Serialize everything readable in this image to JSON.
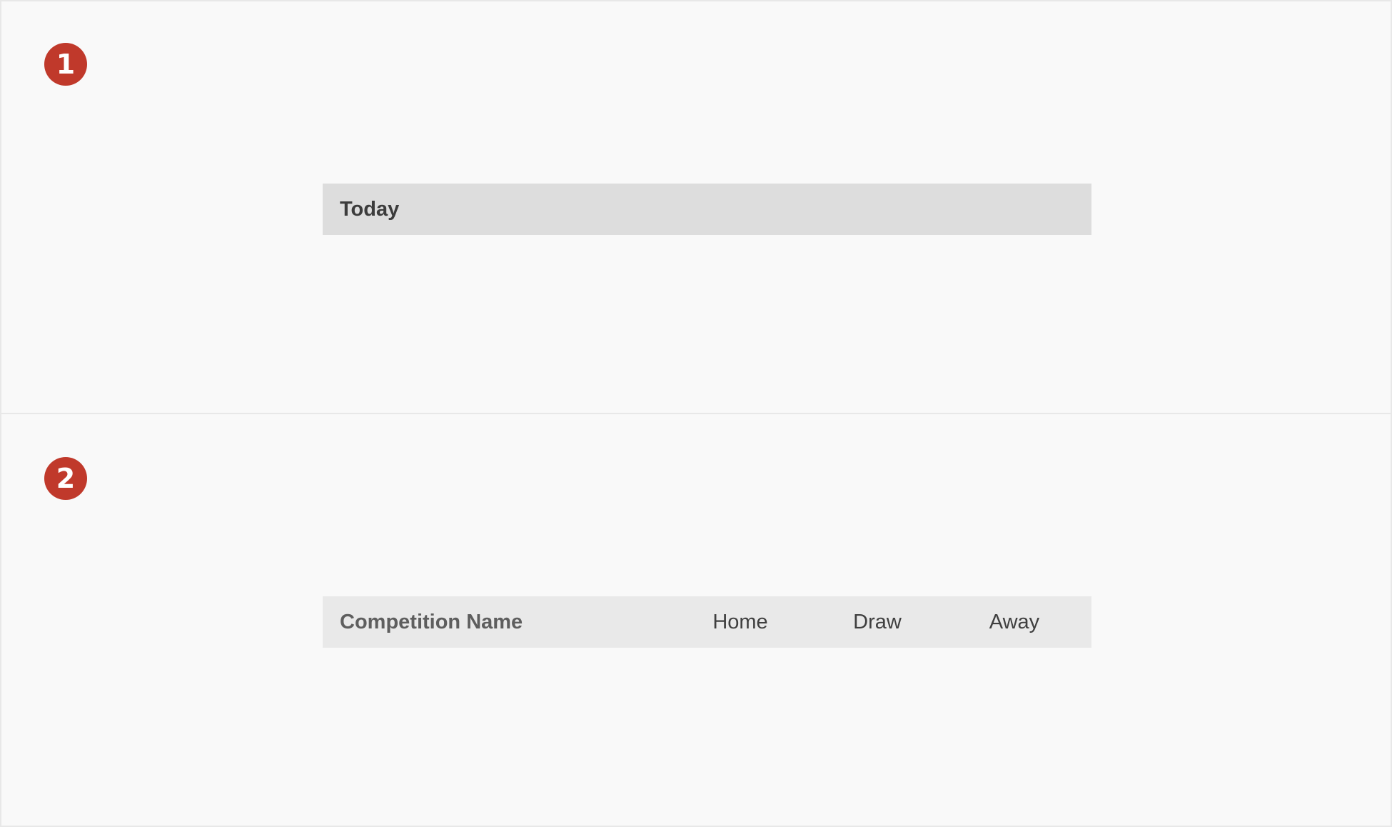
{
  "steps": [
    {
      "number": "1",
      "date_header": {
        "label": "Today"
      }
    },
    {
      "number": "2",
      "competition_header": {
        "name": "Competition Name",
        "columns": [
          "Home",
          "Draw",
          "Away"
        ]
      }
    }
  ],
  "colors": {
    "badge": "#c0392b",
    "date_header_bg": "#dddddd",
    "competition_header_bg": "#e9e9e9",
    "background": "#f9f9f9"
  }
}
